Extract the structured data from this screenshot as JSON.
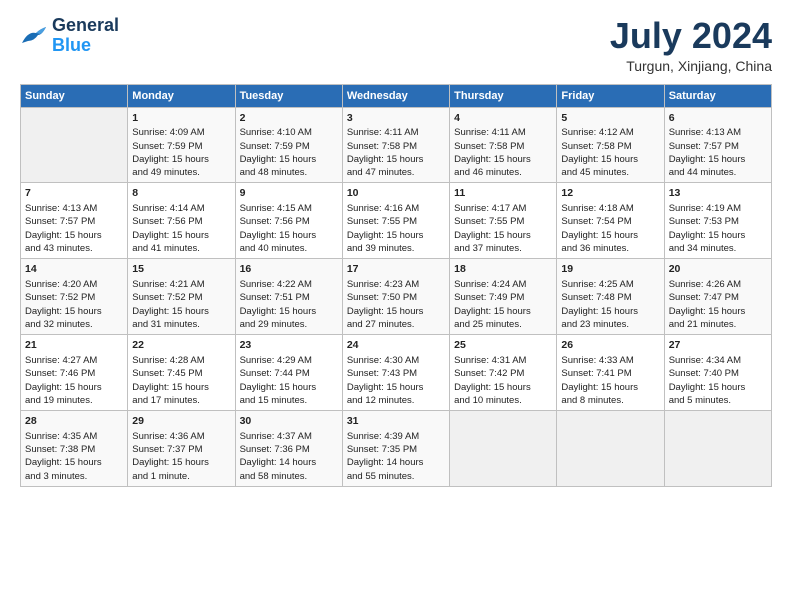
{
  "header": {
    "logo_line1": "General",
    "logo_line2": "Blue",
    "month_title": "July 2024",
    "location": "Turgun, Xinjiang, China"
  },
  "days_of_week": [
    "Sunday",
    "Monday",
    "Tuesday",
    "Wednesday",
    "Thursday",
    "Friday",
    "Saturday"
  ],
  "weeks": [
    [
      {
        "day": "",
        "content": ""
      },
      {
        "day": "1",
        "content": "Sunrise: 4:09 AM\nSunset: 7:59 PM\nDaylight: 15 hours\nand 49 minutes."
      },
      {
        "day": "2",
        "content": "Sunrise: 4:10 AM\nSunset: 7:59 PM\nDaylight: 15 hours\nand 48 minutes."
      },
      {
        "day": "3",
        "content": "Sunrise: 4:11 AM\nSunset: 7:58 PM\nDaylight: 15 hours\nand 47 minutes."
      },
      {
        "day": "4",
        "content": "Sunrise: 4:11 AM\nSunset: 7:58 PM\nDaylight: 15 hours\nand 46 minutes."
      },
      {
        "day": "5",
        "content": "Sunrise: 4:12 AM\nSunset: 7:58 PM\nDaylight: 15 hours\nand 45 minutes."
      },
      {
        "day": "6",
        "content": "Sunrise: 4:13 AM\nSunset: 7:57 PM\nDaylight: 15 hours\nand 44 minutes."
      }
    ],
    [
      {
        "day": "7",
        "content": "Sunrise: 4:13 AM\nSunset: 7:57 PM\nDaylight: 15 hours\nand 43 minutes."
      },
      {
        "day": "8",
        "content": "Sunrise: 4:14 AM\nSunset: 7:56 PM\nDaylight: 15 hours\nand 41 minutes."
      },
      {
        "day": "9",
        "content": "Sunrise: 4:15 AM\nSunset: 7:56 PM\nDaylight: 15 hours\nand 40 minutes."
      },
      {
        "day": "10",
        "content": "Sunrise: 4:16 AM\nSunset: 7:55 PM\nDaylight: 15 hours\nand 39 minutes."
      },
      {
        "day": "11",
        "content": "Sunrise: 4:17 AM\nSunset: 7:55 PM\nDaylight: 15 hours\nand 37 minutes."
      },
      {
        "day": "12",
        "content": "Sunrise: 4:18 AM\nSunset: 7:54 PM\nDaylight: 15 hours\nand 36 minutes."
      },
      {
        "day": "13",
        "content": "Sunrise: 4:19 AM\nSunset: 7:53 PM\nDaylight: 15 hours\nand 34 minutes."
      }
    ],
    [
      {
        "day": "14",
        "content": "Sunrise: 4:20 AM\nSunset: 7:52 PM\nDaylight: 15 hours\nand 32 minutes."
      },
      {
        "day": "15",
        "content": "Sunrise: 4:21 AM\nSunset: 7:52 PM\nDaylight: 15 hours\nand 31 minutes."
      },
      {
        "day": "16",
        "content": "Sunrise: 4:22 AM\nSunset: 7:51 PM\nDaylight: 15 hours\nand 29 minutes."
      },
      {
        "day": "17",
        "content": "Sunrise: 4:23 AM\nSunset: 7:50 PM\nDaylight: 15 hours\nand 27 minutes."
      },
      {
        "day": "18",
        "content": "Sunrise: 4:24 AM\nSunset: 7:49 PM\nDaylight: 15 hours\nand 25 minutes."
      },
      {
        "day": "19",
        "content": "Sunrise: 4:25 AM\nSunset: 7:48 PM\nDaylight: 15 hours\nand 23 minutes."
      },
      {
        "day": "20",
        "content": "Sunrise: 4:26 AM\nSunset: 7:47 PM\nDaylight: 15 hours\nand 21 minutes."
      }
    ],
    [
      {
        "day": "21",
        "content": "Sunrise: 4:27 AM\nSunset: 7:46 PM\nDaylight: 15 hours\nand 19 minutes."
      },
      {
        "day": "22",
        "content": "Sunrise: 4:28 AM\nSunset: 7:45 PM\nDaylight: 15 hours\nand 17 minutes."
      },
      {
        "day": "23",
        "content": "Sunrise: 4:29 AM\nSunset: 7:44 PM\nDaylight: 15 hours\nand 15 minutes."
      },
      {
        "day": "24",
        "content": "Sunrise: 4:30 AM\nSunset: 7:43 PM\nDaylight: 15 hours\nand 12 minutes."
      },
      {
        "day": "25",
        "content": "Sunrise: 4:31 AM\nSunset: 7:42 PM\nDaylight: 15 hours\nand 10 minutes."
      },
      {
        "day": "26",
        "content": "Sunrise: 4:33 AM\nSunset: 7:41 PM\nDaylight: 15 hours\nand 8 minutes."
      },
      {
        "day": "27",
        "content": "Sunrise: 4:34 AM\nSunset: 7:40 PM\nDaylight: 15 hours\nand 5 minutes."
      }
    ],
    [
      {
        "day": "28",
        "content": "Sunrise: 4:35 AM\nSunset: 7:38 PM\nDaylight: 15 hours\nand 3 minutes."
      },
      {
        "day": "29",
        "content": "Sunrise: 4:36 AM\nSunset: 7:37 PM\nDaylight: 15 hours\nand 1 minute."
      },
      {
        "day": "30",
        "content": "Sunrise: 4:37 AM\nSunset: 7:36 PM\nDaylight: 14 hours\nand 58 minutes."
      },
      {
        "day": "31",
        "content": "Sunrise: 4:39 AM\nSunset: 7:35 PM\nDaylight: 14 hours\nand 55 minutes."
      },
      {
        "day": "",
        "content": ""
      },
      {
        "day": "",
        "content": ""
      },
      {
        "day": "",
        "content": ""
      }
    ]
  ]
}
